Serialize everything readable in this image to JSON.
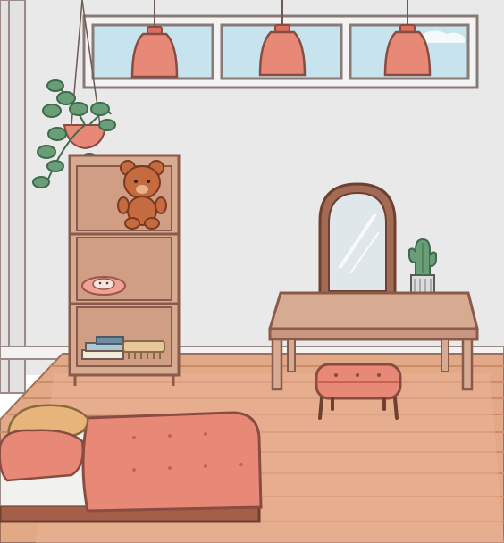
{
  "scene": {
    "description_free": true,
    "palette": {
      "wall": "#e9e9e9",
      "outline": "#8a6a5e",
      "floor": "#e2a987",
      "floor_line": "#c98d6c",
      "wood": "#d7aa92",
      "wood_dark": "#a36a56",
      "coral": "#e88978",
      "coral_dark": "#c9624f",
      "window_sky": "#c7e4ee",
      "plant_green": "#6a9e78",
      "plant_dark": "#3f6a4c",
      "mirror_glass": "#dfe7ea",
      "pillow_yellow": "#e7b57c",
      "white_sheet": "#f1f1ef"
    },
    "objects": {
      "lamps": [
        "pendant-lamp",
        "pendant-lamp",
        "pendant-lamp"
      ],
      "plant": "hanging-plant",
      "shelf": "bookshelf",
      "shelf_items": [
        "teddy-bear",
        "bunny-slippers",
        "books",
        "hair-comb"
      ],
      "vanity": "vanity-table",
      "mirror": "arched-mirror",
      "cactus": "potted-cactus",
      "stool": "tufted-stool",
      "bed": "bed-with-pillows"
    }
  }
}
